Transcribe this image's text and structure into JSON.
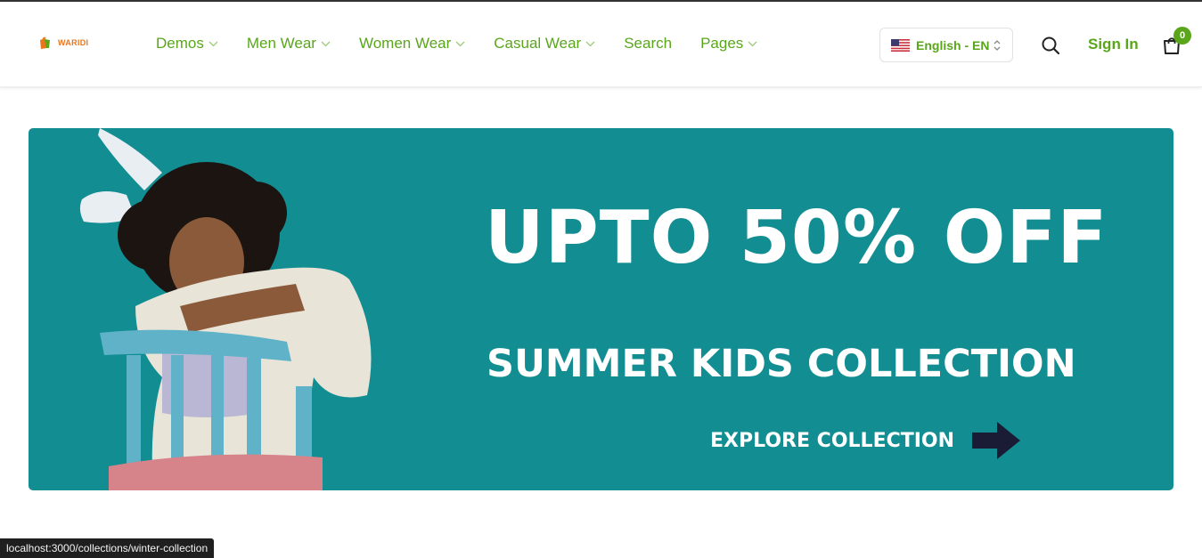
{
  "brand": {
    "name": "WARIDI",
    "accent_color": "#5aa61b",
    "logo_color": "#e8761c"
  },
  "nav": {
    "items": [
      {
        "label": "Demos",
        "has_dropdown": true
      },
      {
        "label": "Men Wear",
        "has_dropdown": true
      },
      {
        "label": "Women Wear",
        "has_dropdown": true
      },
      {
        "label": "Casual Wear",
        "has_dropdown": true
      },
      {
        "label": "Search",
        "has_dropdown": false
      },
      {
        "label": "Pages",
        "has_dropdown": true
      }
    ]
  },
  "language": {
    "flag_icon": "us-flag-icon",
    "label": "English - EN"
  },
  "header_actions": {
    "search_icon": "search-icon",
    "signin_label": "Sign In",
    "cart_icon": "shopping-bag-icon",
    "cart_count": "0"
  },
  "banner": {
    "background_color": "#128e93",
    "headline": "UPTO 50% OFF",
    "subline": "SUMMER KIDS COLLECTION",
    "cta_label": "EXPLORE COLLECTION",
    "cta_icon": "arrow-right-icon"
  },
  "status_bar": {
    "url": "localhost:3000/collections/winter-collection"
  }
}
